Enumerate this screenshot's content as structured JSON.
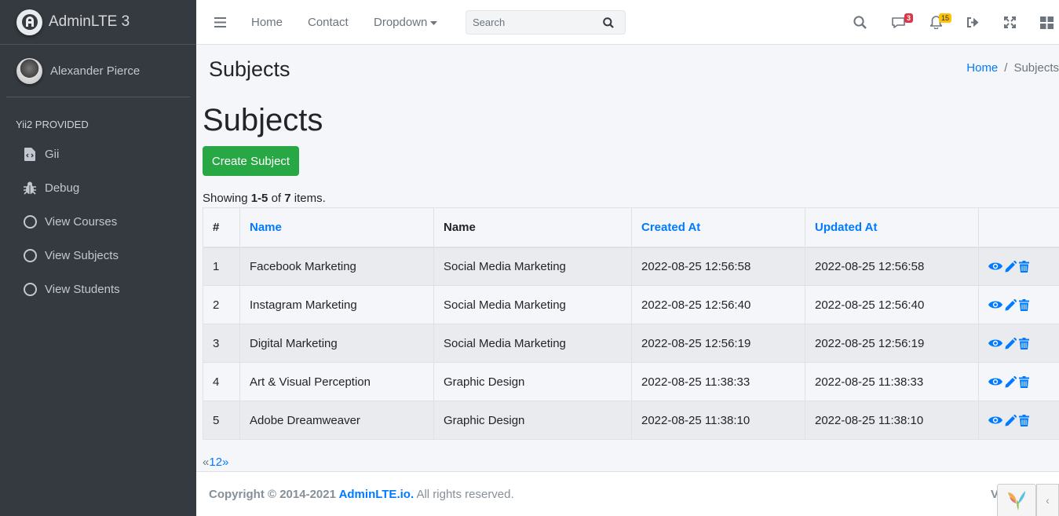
{
  "sidebar": {
    "brand": "AdminLTE 3",
    "user_name": "Alexander Pierce",
    "section_header": "Yii2 PROVIDED",
    "items": [
      {
        "label": "Gii",
        "icon": "file-code-icon"
      },
      {
        "label": "Debug",
        "icon": "bug-icon"
      },
      {
        "label": "View Courses",
        "icon": "circle-icon"
      },
      {
        "label": "View Subjects",
        "icon": "circle-icon"
      },
      {
        "label": "View Students",
        "icon": "circle-icon"
      }
    ]
  },
  "topbar": {
    "nav": [
      "Home",
      "Contact",
      "Dropdown"
    ],
    "search_placeholder": "Search",
    "messages_badge": "3",
    "notifications_badge": "15",
    "badge_colors": {
      "messages": "#dc3545",
      "notifications": "#ffc107"
    }
  },
  "page": {
    "header_title": "Subjects",
    "breadcrumb": {
      "home": "Home",
      "separator": "/",
      "current": "Subjects"
    },
    "title": "Subjects",
    "create_button": "Create Subject",
    "summary": {
      "prefix": "Showing ",
      "range": "1-5",
      "of": " of ",
      "total": "7",
      "suffix": " items."
    }
  },
  "table": {
    "headers": [
      "#",
      "Name",
      "Name",
      "Created At",
      "Updated At",
      ""
    ],
    "rows": [
      {
        "num": "1",
        "name": "Facebook Marketing",
        "category": "Social Media Marketing",
        "created": "2022-08-25 12:56:58",
        "updated": "2022-08-25 12:56:58"
      },
      {
        "num": "2",
        "name": "Instagram Marketing",
        "category": "Social Media Marketing",
        "created": "2022-08-25 12:56:40",
        "updated": "2022-08-25 12:56:40"
      },
      {
        "num": "3",
        "name": "Digital Marketing",
        "category": "Social Media Marketing",
        "created": "2022-08-25 12:56:19",
        "updated": "2022-08-25 12:56:19"
      },
      {
        "num": "4",
        "name": "Art & Visual Perception",
        "category": "Graphic Design",
        "created": "2022-08-25 11:38:33",
        "updated": "2022-08-25 11:38:33"
      },
      {
        "num": "5",
        "name": "Adobe Dreamweaver",
        "category": "Graphic Design",
        "created": "2022-08-25 11:38:10",
        "updated": "2022-08-25 11:38:10"
      }
    ]
  },
  "pager": {
    "prev": "«",
    "pages": [
      "1",
      "2"
    ],
    "next": "»"
  },
  "footer": {
    "copyright_prefix": "Copyright © 2014-2021 ",
    "brand": "AdminLTE.io.",
    "rights": " All rights reserved.",
    "version_fragment": "V"
  },
  "colors": {
    "accent": "#007bff",
    "success": "#28a745",
    "sidebar": "#343a40"
  }
}
